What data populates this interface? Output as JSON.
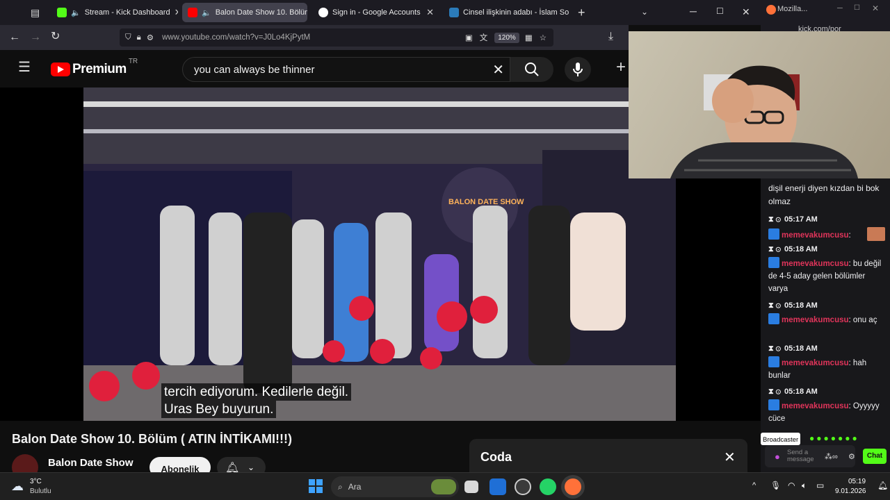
{
  "browser": {
    "tabs": [
      {
        "label": "Stream - Kick Dashboard",
        "color": "#53fc18"
      },
      {
        "label": "Balon Date Show 10. Bölüm",
        "color": "#ff0000"
      },
      {
        "label": "Sign in - Google Accounts",
        "color": "#4285f4"
      },
      {
        "label": "Cinsel ilişkinin adabı - İslam Soru",
        "color": "#2b7bb9"
      }
    ],
    "url": "www.youtube.com/watch?v=J0Lo4KjPytM",
    "zoom": "120%",
    "second_window_title": "Mozilla...",
    "second_window_url": "kick.com/por"
  },
  "youtube": {
    "logo": "Premium",
    "country": "TR",
    "search_value": "you can always be thinner",
    "video_caption_line1": "tercih ediyorum. Kedilerle değil.",
    "video_caption_line2": "Uras Bey buyurun.",
    "sign_text": "BALON DATE SHOW",
    "video_title": "Balon Date Show 10. Bölüm ( ATIN İNTİKAMI!!!)",
    "channel": "Balon Date Show",
    "subscribe": "Abonelik",
    "coda_title": "Coda"
  },
  "chat": {
    "top_message": "dişil enerji diyen kızdan bi bok olmaz",
    "messages": [
      {
        "time": "05:17 AM",
        "user": "memevakumcusu",
        "text": ""
      },
      {
        "time": "05:18 AM",
        "user": "memevakumcusu",
        "text": "bu değil de 4-5 aday gelen bölümler varya"
      },
      {
        "time": "05:18 AM",
        "user": "memevakumcusu",
        "text": "onu aç"
      },
      {
        "time": "05:18 AM",
        "user": "memevakumcusu",
        "text": "hah bunlar"
      },
      {
        "time": "05:18 AM",
        "user": "memevakumcusu",
        "text": "Oyyyyy cüce"
      }
    ],
    "broadcaster": "Broadcaster",
    "placeholder": "Send a message",
    "send": "Chat"
  },
  "taskbar": {
    "weather_temp": "3°C",
    "weather_desc": "Bulutlu",
    "search": "Ara",
    "time": "05:19",
    "date": "9.01.2026"
  }
}
